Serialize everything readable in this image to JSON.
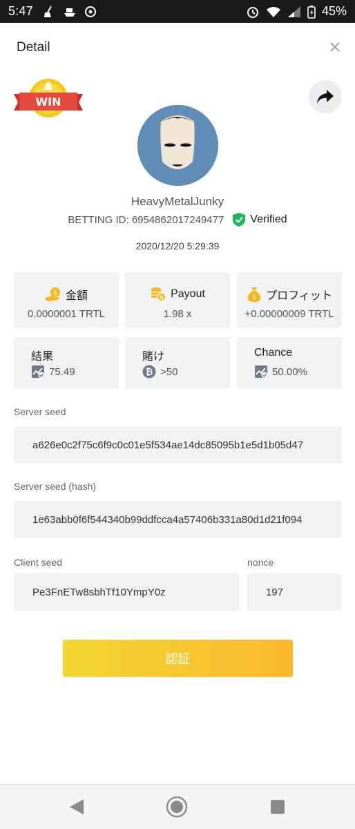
{
  "status_bar": {
    "time": "5:47",
    "battery": "45%",
    "left_icons": [
      "broom-icon",
      "ship-icon",
      "cast-icon"
    ],
    "right_icons": [
      "alarm-icon",
      "wifi-icon",
      "signal-icon",
      "battery-icon"
    ]
  },
  "header": {
    "title": "Detail",
    "close_icon": "close-icon"
  },
  "badge": {
    "text": "WIN"
  },
  "profile": {
    "username": "HeavyMetalJunky",
    "betting_id": "BETTING ID: 6954862017249477",
    "verified_label": "Verified",
    "date": "2020/12/20 5:29:39"
  },
  "stats_top": [
    {
      "label": "金額",
      "value": "0.0000001 TRTL",
      "icon": "money-hand-icon"
    },
    {
      "label": "Payout",
      "value": "1.98 x",
      "icon": "coin-stack-icon"
    },
    {
      "label": "プロフィット",
      "value": "+0.00000009 TRTL",
      "icon": "money-bag-icon"
    }
  ],
  "stats_bottom": [
    {
      "label": "結果",
      "value": "75.49",
      "icon": "chart-check-icon"
    },
    {
      "label": "賭け",
      "value": ">50",
      "icon": "bitcoin-icon"
    },
    {
      "label": "Chance",
      "value": "50.00%",
      "icon": "chart-check-icon"
    }
  ],
  "fields": {
    "server_seed_label": "Server seed",
    "server_seed": "a626e0c2f75c6f9c0c01e5f534ae14dc85095b1e5d1b05d47",
    "server_seed_hash_label": "Server seed (hash)",
    "server_seed_hash": "1e63abb0f6f544340b99ddfcca4a57406b331a80d1d21f094",
    "client_seed_label": "Client seed",
    "client_seed": "Pe3FnETw8sbhTf10YmpY0z",
    "nonce_label": "nonce",
    "nonce": "197"
  },
  "verify_button": {
    "label": "認証"
  },
  "colors": {
    "accent_start": "#f2d632",
    "accent_end": "#fbb92d",
    "card_bg": "#f1f2f4",
    "verified_green": "#1db954"
  }
}
